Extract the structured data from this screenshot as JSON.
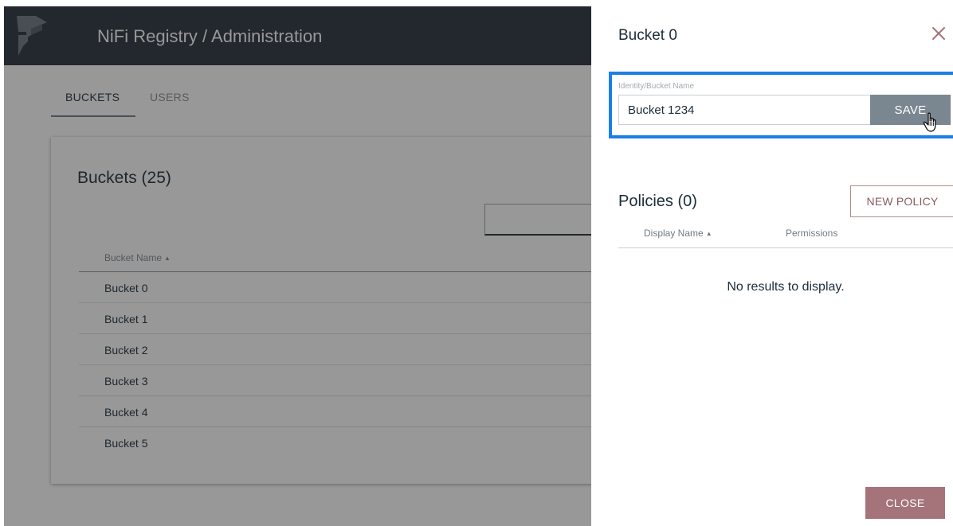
{
  "app": {
    "title": "NiFi Registry / Administration",
    "tabs": [
      {
        "label": "BUCKETS",
        "active": true
      },
      {
        "label": "USERS",
        "active": false
      }
    ]
  },
  "buckets": {
    "title": "Buckets (25)",
    "column_header": "Bucket Name",
    "rows": [
      "Bucket 0",
      "Bucket 1",
      "Bucket 2",
      "Bucket 3",
      "Bucket 4",
      "Bucket 5"
    ]
  },
  "panel": {
    "title": "Bucket 0",
    "field_label": "Identity/Bucket Name",
    "field_value": "Bucket 1234",
    "save_label": "SAVE",
    "policies_title": "Policies (0)",
    "new_policy_label": "NEW POLICY",
    "col_display_name": "Display Name",
    "col_permissions": "Permissions",
    "no_results": "No results to display.",
    "close_label": "CLOSE"
  },
  "colors": {
    "topbar": "#25313a",
    "highlight": "#1a7fe8",
    "save_button": "#7a8791",
    "close_button": "#a5737a",
    "accent": "#a5737a"
  },
  "icons": {
    "logo": "nifi-registry-logo-icon",
    "close": "close-icon",
    "cursor": "hand-pointer-icon",
    "sort": "sort-ascending-icon"
  }
}
